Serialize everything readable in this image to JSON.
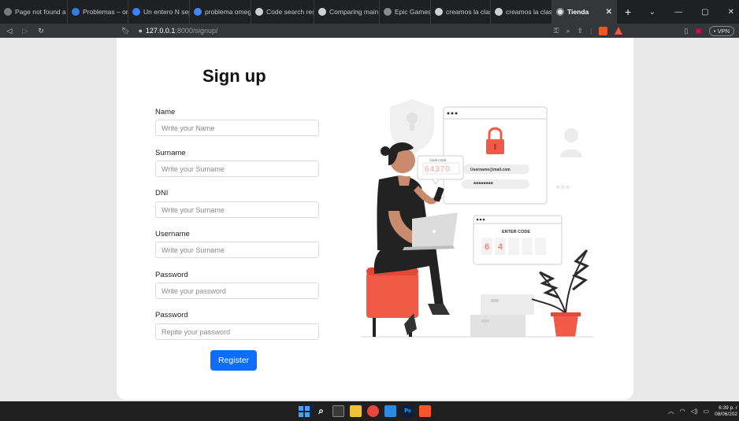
{
  "browser": {
    "tabs": [
      {
        "label": "Page not found a",
        "icon": "globe-icon",
        "color": "#7a7a7a"
      },
      {
        "label": "Problemas – ome",
        "icon": "omega-icon",
        "color": "#2f7de1"
      },
      {
        "label": "Un entero N sep",
        "icon": "puzzle-icon",
        "color": "#3b82f6"
      },
      {
        "label": "problema omega",
        "icon": "google-icon",
        "color": "#4285f4"
      },
      {
        "label": "Code search resu",
        "icon": "github-icon",
        "color": "#d0d0d0"
      },
      {
        "label": "Comparing main",
        "icon": "github-icon",
        "color": "#d0d0d0"
      },
      {
        "label": "Epic Games",
        "icon": "epic-icon",
        "color": "#8a8a8a"
      },
      {
        "label": "creamos la clase",
        "icon": "github-icon",
        "color": "#d0d0d0"
      },
      {
        "label": "creamos la clase",
        "icon": "github-icon",
        "color": "#d0d0d0"
      }
    ],
    "active_tab": "Tienda",
    "url_host": "127.0.0.1",
    "url_path": ":8000/signup/",
    "vpn_label": "• VPN"
  },
  "signup": {
    "title": "Sign up",
    "fields": [
      {
        "label": "Name",
        "placeholder": "Write your Name",
        "type": "text"
      },
      {
        "label": "Surname",
        "placeholder": "Write your Surname",
        "type": "text"
      },
      {
        "label": "DNI",
        "placeholder": "Write your Surname",
        "type": "text"
      },
      {
        "label": "Username",
        "placeholder": "Write your Surname",
        "type": "text"
      },
      {
        "label": "Password",
        "placeholder": "Write your password",
        "type": "password"
      },
      {
        "label": "Password",
        "placeholder": "Repite your password",
        "type": "password"
      }
    ],
    "register_label": "Register",
    "accent_color": "#0d6efd"
  },
  "illustration": {
    "your_code_label": "YOUR CODE",
    "code_digits": "64370",
    "email_text": "Username@mail.com",
    "password_mask": "********",
    "asterisks": "***",
    "enter_code_label": "ENTER CODE",
    "entered_digits": [
      "6",
      "4",
      "",
      "",
      ""
    ],
    "accent_color": "#f05a46"
  },
  "taskbar": {
    "clock_time": "6:39 p. r",
    "clock_date": "08/06/202"
  }
}
